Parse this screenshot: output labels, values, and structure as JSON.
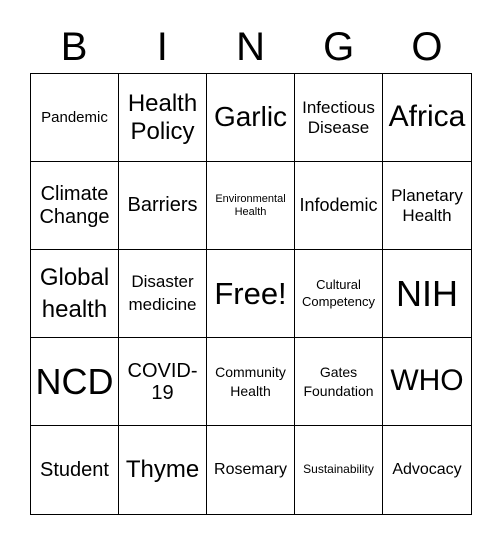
{
  "header": [
    "B",
    "I",
    "N",
    "G",
    "O"
  ],
  "cells": [
    "Pandemic",
    "Health Policy",
    "Garlic",
    "Infectious Disease",
    "Africa",
    "Climate Change",
    "Barriers",
    "Environmental Health",
    "Infodemic",
    "Planetary Health",
    "Global health",
    "Disaster medicine",
    "Free!",
    "Cultural Competency",
    "NIH",
    "NCD",
    "COVID-19",
    "Community Health",
    "Gates Foundation",
    "WHO",
    "Student",
    "Thyme",
    "Rosemary",
    "Sustainability",
    "Advocacy"
  ]
}
